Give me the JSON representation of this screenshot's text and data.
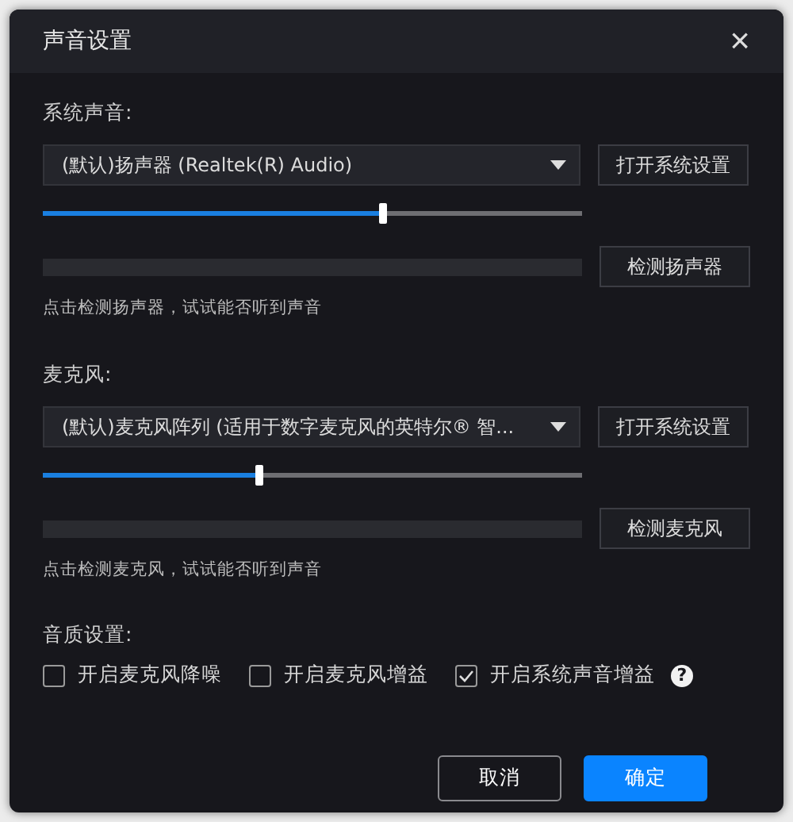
{
  "dialog": {
    "title": "声音设置",
    "close": "×"
  },
  "sections": [
    {
      "label": "系统声音:",
      "device": "(默认)扬声器 (Realtek(R) Audio)",
      "settings_button": "打开系统设置",
      "volume": {
        "level": 0.63
      },
      "meter": {
        "level": 0
      },
      "test_button": "检测扬声器",
      "hint": "点击检测扬声器，试试能否听到声音"
    },
    {
      "label": "麦克风:",
      "device": "(默认)麦克风阵列 (适用于数字麦克风的英特尔® 智...",
      "settings_button": "打开系统设置",
      "volume": {
        "level": 0.4
      },
      "meter": {
        "level": 0
      },
      "test_button": "检测麦克风",
      "hint": "点击检测麦克风，试试能否听到声音"
    }
  ],
  "quality": {
    "label": "音质设置:",
    "options": [
      {
        "label": "开启麦克风降噪",
        "checked": false
      },
      {
        "label": "开启麦克风增益",
        "checked": false
      },
      {
        "label": "开启系统声音增益",
        "checked": true,
        "help": "?"
      }
    ]
  },
  "buttons": [
    {
      "label": "取消",
      "kind": "secondary"
    },
    {
      "label": "确定",
      "kind": "primary"
    }
  ]
}
